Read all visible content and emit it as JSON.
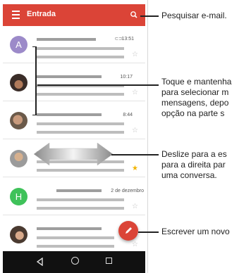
{
  "app_bar": {
    "title": "Entrada"
  },
  "emails": [
    {
      "avatar_letter": "A",
      "time": "13:51",
      "attachment": true,
      "starred": false
    },
    {
      "avatar_letter": "",
      "time": "10:17",
      "attachment": false,
      "starred": false
    },
    {
      "avatar_letter": "",
      "time": "8:44",
      "attachment": false,
      "starred": false
    },
    {
      "avatar_letter": "",
      "time": "",
      "attachment": false,
      "starred": true
    },
    {
      "avatar_letter": "H",
      "time": "2 de dezembro",
      "attachment": false,
      "starred": false
    },
    {
      "avatar_letter": "",
      "time": "",
      "attachment": false,
      "starred": false
    }
  ],
  "callouts": {
    "search": "Pesquisar e-mail.",
    "select_line1": "Toque e mantenha",
    "select_line2": "para selecionar m",
    "select_line3": "mensagens, depo",
    "select_line4": "opção na parte s",
    "swipe_line1": "Deslize para a es",
    "swipe_line2": "para a direita par",
    "swipe_line3": "uma conversa.",
    "compose": "Escrever um novo"
  },
  "colors": {
    "accent": "#db4437",
    "star": "#f2b400"
  },
  "icons": {
    "menu": "menu-icon",
    "search": "search-icon",
    "compose": "pencil-icon",
    "back": "back-icon",
    "home": "home-icon",
    "recents": "recents-icon"
  }
}
